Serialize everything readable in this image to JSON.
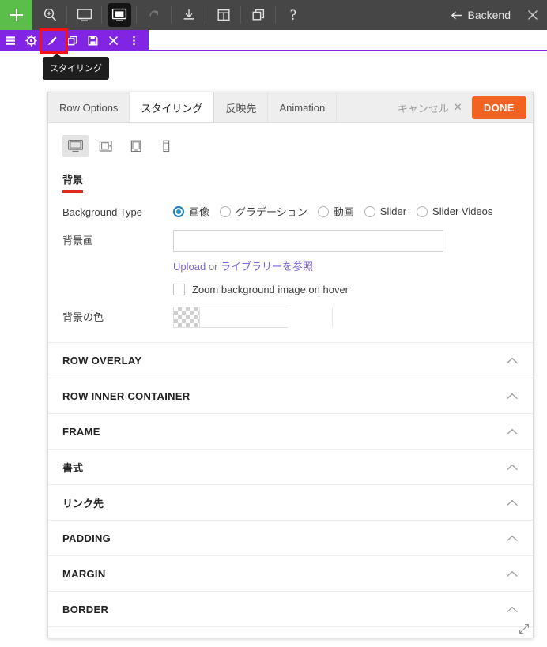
{
  "topbar": {
    "add_label": "+",
    "tools": [
      {
        "name": "zoom-in-icon",
        "label": "Zoom"
      },
      {
        "name": "preview-desktop-icon",
        "label": "Preview"
      },
      {
        "name": "frontend-editor-icon",
        "label": "Frontend Editor"
      },
      {
        "name": "redo-icon",
        "label": "Redo"
      },
      {
        "name": "save-download-icon",
        "label": "Save"
      },
      {
        "name": "layout-icon",
        "label": "Layout"
      },
      {
        "name": "duplicate-icon",
        "label": "Duplicate"
      },
      {
        "name": "help-icon",
        "label": "?"
      }
    ],
    "help_glyph": "?",
    "backend_label": "Backend",
    "close_glyph": "✕"
  },
  "rowbar": {
    "buttons": [
      {
        "name": "row-layout-icon",
        "label": "Row layout"
      },
      {
        "name": "row-settings-icon",
        "label": "Row settings"
      },
      {
        "name": "row-styling-icon",
        "label": "Styling"
      },
      {
        "name": "row-duplicate-icon",
        "label": "Duplicate row"
      },
      {
        "name": "row-save-icon",
        "label": "Save row"
      },
      {
        "name": "row-delete-icon",
        "label": "Delete row"
      },
      {
        "name": "row-more-icon",
        "label": "More"
      }
    ],
    "tooltip": "スタイリング"
  },
  "panel": {
    "tabs": [
      {
        "label": "Row Options",
        "active": false
      },
      {
        "label": "スタイリング",
        "active": true
      },
      {
        "label": "反映先",
        "active": false
      },
      {
        "label": "Animation",
        "active": false
      }
    ],
    "cancel_label": "キャンセル",
    "cancel_glyph": "✕",
    "done_label": "DONE",
    "devices": [
      {
        "name": "device-desktop",
        "active": true
      },
      {
        "name": "device-laptop",
        "active": false
      },
      {
        "name": "device-tablet",
        "active": false
      },
      {
        "name": "device-mobile",
        "active": false
      }
    ],
    "section_title": "背景",
    "background_type": {
      "label": "Background Type",
      "options": [
        {
          "label": "画像",
          "selected": true
        },
        {
          "label": "グラデーション",
          "selected": false
        },
        {
          "label": "動画",
          "selected": false
        },
        {
          "label": "Slider",
          "selected": false
        },
        {
          "label": "Slider Videos",
          "selected": false
        }
      ]
    },
    "background_image": {
      "label": "背景画",
      "value": "",
      "placeholder": "",
      "upload_label": "Upload",
      "or_label": "or",
      "library_label": "ライブラリーを参照",
      "zoom_checkbox_label": "Zoom background image on hover",
      "zoom_checked": false
    },
    "background_color": {
      "label": "背景の色",
      "value": "",
      "alpha": "",
      "swatch": "transparent"
    },
    "accordions": [
      {
        "label": "ROW OVERLAY",
        "jp": false
      },
      {
        "label": "ROW INNER CONTAINER",
        "jp": false
      },
      {
        "label": "FRAME",
        "jp": false
      },
      {
        "label": "書式",
        "jp": true
      },
      {
        "label": "リンク先",
        "jp": true
      },
      {
        "label": "PADDING",
        "jp": false
      },
      {
        "label": "MARGIN",
        "jp": false
      },
      {
        "label": "BORDER",
        "jp": false
      }
    ]
  },
  "colors": {
    "topbar_bg": "#464646",
    "add_green": "#5cbe4a",
    "rowbar_purple": "#8224e3",
    "done_orange": "#f26322",
    "section_underline_red": "#e02b20",
    "highlight_red": "#f21414",
    "radio_blue": "#2196d3",
    "link_purple": "#7d5fe0"
  }
}
